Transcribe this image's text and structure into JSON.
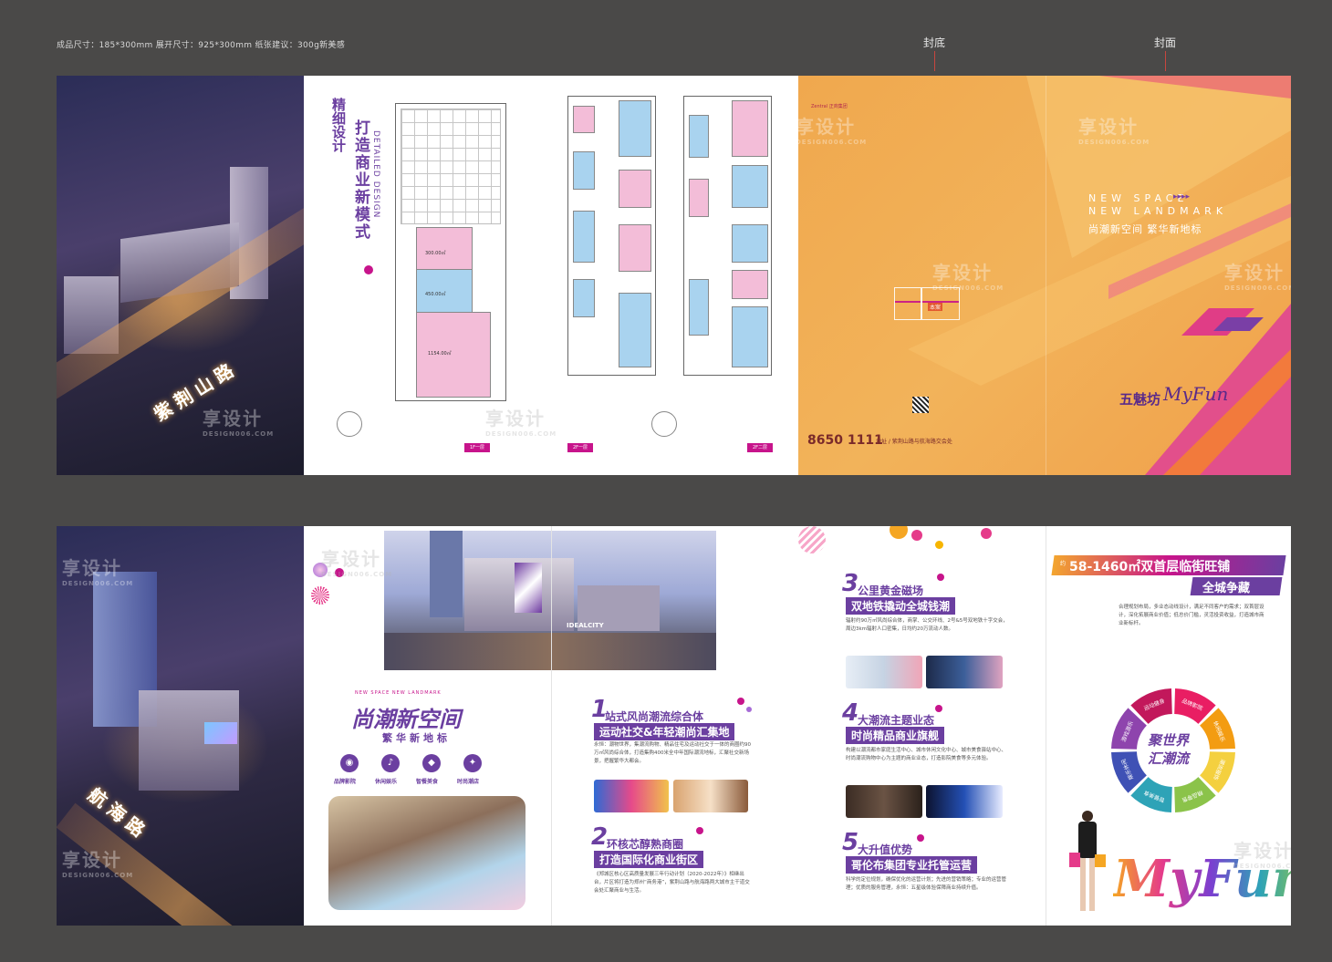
{
  "spec_line": "成品尺寸：185*300mm  展开尺寸：925*300mm   纸张建议：300g新美感",
  "labels": {
    "back_cover": "封底",
    "front_cover": "封面"
  },
  "watermark": {
    "text": "享设计",
    "domain": "DESIGN006.COM"
  },
  "top_sheet": {
    "aerial_road": "紫荆山路",
    "design_title_a": "精细设计",
    "design_title_b": "打造商业新模式",
    "design_subtitle": "DETAILED DESIGN",
    "floor_tags": [
      "1F一层",
      "2F一层",
      "2F二层"
    ],
    "areas": [
      "300.00㎡",
      "450.00㎡",
      "1154.00㎡"
    ],
    "colors": {
      "orange": "#f0a84e",
      "magenta": "#c7148b",
      "purple": "#6b3fa0",
      "pink": "#f3bdd8",
      "blue": "#a9d3ef"
    },
    "cover": {
      "top_brand": "Zentral 正商集团",
      "en_line1": "NEW SPACE",
      "en_line2": "NEW LANDMARK",
      "slogan": "尚潮新空间  繁华新地标",
      "phone": "8650 1111",
      "address": "地址 / 紫荆山路与航海路交会处",
      "logo_cn": "五魅坊",
      "logo_en": "MyFun",
      "map_label": "本案"
    }
  },
  "bottom_sheet": {
    "aerial_road": "航海路",
    "building_sign": "IDEALCITY",
    "heading_en": "NEW SPACE NEW LANDMARK",
    "heading_main": "尚潮新空间",
    "heading_sub": "繁华新地标",
    "icons": [
      {
        "name": "film-icon",
        "label": "品牌影院"
      },
      {
        "name": "leisure-icon",
        "label": "休闲娱乐"
      },
      {
        "name": "dining-icon",
        "label": "智餐美食"
      },
      {
        "name": "fashion-icon",
        "label": "时尚潮店"
      }
    ],
    "sections": [
      {
        "num": "1",
        "title": "站式风尚潮流综合体",
        "bar": "运动社交&年轻潮尚汇集地",
        "text": "永恒：潮物世界，集潮流购物、精品住宅及运动社交于一体的商圈约90万㎡风尚综合体，打造集购400米全中年国际潮流地标，汇聚社交新场景，把握繁华大都会。"
      },
      {
        "num": "2",
        "title": "环核芯醇熟商圈",
        "bar": "打造国际化商业街区",
        "text": "《郑城区核心区高质量发展三年行动计划（2020-2022年）》相继出台，片区将打造为郑州“商务港”，紫荆山路与航海路两大城市主干道交会处汇聚商业与生活。"
      },
      {
        "num": "3",
        "title": "公里黄金磁场",
        "bar": "双地铁撬动全城钱潮",
        "text": "辐射约90万㎡风尚综合体，商掌、公交环线、2号&5号双地铁十字交会，周边3km辐射人口密集，日均约20万流动人数。"
      },
      {
        "num": "4",
        "title": "大潮流主题业态",
        "bar": "时尚精品商业旗舰",
        "text": "构建以潮流都市家庭生活中心、城市休闲文化中心、城市美食驿站中心、时尚潮流购物中心为主题的商业业态，打造影院美食等多元体验。"
      },
      {
        "num": "5",
        "title": "大升值优势",
        "bar": "哥伦布集团专业托管运营",
        "text": "科学的定位规划，确保优化的运营计划；先进的营销策略；专业的运营管理；优质的服务管理，永恒：五星级体验保障商业持续升值。"
      }
    ],
    "right_panel": {
      "headline": "58-1460㎡双首层临街旺铺",
      "headline_prefix": "约",
      "sub": "全城争藏",
      "text": "合理规划布局，多业态动线设计，满足不同客户的需求；双首层设计，深化拓展商业价值；低总价门槛，灵活投资收益，打造城市商业新标杆。",
      "wheel_center_1": "聚世界",
      "wheel_center_2": "汇潮流",
      "wheel_segments": [
        "品牌影院",
        "休闲娱乐",
        "潮流服饰",
        "精品零售",
        "智餐美食",
        "娱乐休闲",
        "游戏游乐",
        "运动健身"
      ],
      "wheel_colors": [
        "#e91e63",
        "#f39c12",
        "#f4d03f",
        "#8bc34a",
        "#2ea3b7",
        "#3f51b5",
        "#8e44ad",
        "#c2185b"
      ],
      "logo_en": "MyFun"
    }
  }
}
